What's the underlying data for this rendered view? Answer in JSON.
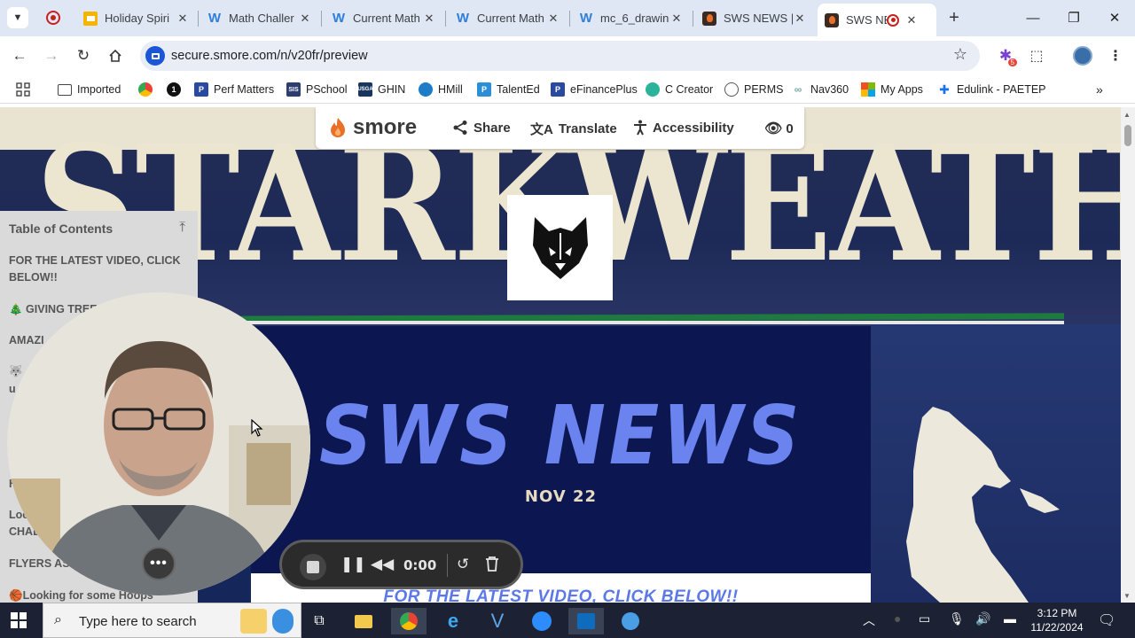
{
  "browser": {
    "tabs": [
      {
        "label": "Holiday Spiri",
        "icon": "slides-icon",
        "color": "#f4b400"
      },
      {
        "label": "Math Challer",
        "icon": "weebly-icon",
        "color": "#2f7fd8"
      },
      {
        "label": "Current Math",
        "icon": "weebly-icon",
        "color": "#2f7fd8"
      },
      {
        "label": "Current Math",
        "icon": "weebly-icon",
        "color": "#2f7fd8"
      },
      {
        "label": "mc_6_drawin",
        "icon": "weebly-icon",
        "color": "#2f7fd8"
      },
      {
        "label": "SWS NEWS |",
        "icon": "smore-icon",
        "color": "#e8702a"
      },
      {
        "label": "SWS NEV",
        "icon": "smore-icon",
        "color": "#e8702a"
      }
    ],
    "url": "secure.smore.com/n/v20fr/preview",
    "extension_badge": "5",
    "bookmarks": [
      {
        "label": "Imported",
        "icon": "folder-icon"
      },
      {
        "label": "",
        "icon": "chrome-color-icon"
      },
      {
        "label": "",
        "icon": "onepassword-icon"
      },
      {
        "label": "Perf Matters",
        "icon": "p-icon"
      },
      {
        "label": "PSchool",
        "icon": "sis-icon"
      },
      {
        "label": "GHIN",
        "icon": "usga-icon"
      },
      {
        "label": "HMill",
        "icon": "hmill-icon"
      },
      {
        "label": "TalentEd",
        "icon": "talented-icon"
      },
      {
        "label": "eFinancePlus",
        "icon": "p-icon"
      },
      {
        "label": "C Creator",
        "icon": "creator-icon"
      },
      {
        "label": "PERMS",
        "icon": "globe-icon"
      },
      {
        "label": "Nav360",
        "icon": "nav360-icon"
      },
      {
        "label": "My Apps",
        "icon": "microsoft-icon"
      },
      {
        "label": "Edulink - PAETEP",
        "icon": "puzzle-icon"
      }
    ]
  },
  "smore": {
    "logo": "smore",
    "share": "Share",
    "translate": "Translate",
    "accessibility": "Accessibility",
    "views": "0"
  },
  "banner": {
    "text": "STARKWEATHER"
  },
  "newsletter": {
    "title": "SWS NEWS",
    "date": "NOV 22",
    "section_heading": "FOR THE LATEST VIDEO, CLICK BELOW!!"
  },
  "toc": {
    "heading": "Table of Contents",
    "items": [
      "FOR THE LATEST VIDEO, CLICK BELOW!!",
      "🎄 GIVING TREE",
      "AMAZI",
      "🐺",
      "u",
      "H",
      "Loc",
      "CHAL",
      "FLYERS ASS",
      "🏀Looking for some Hoops"
    ]
  },
  "recorder": {
    "time": "0:00"
  },
  "taskbar": {
    "search_placeholder": "Type here to search",
    "time": "3:12 PM",
    "date": "11/22/2024"
  }
}
